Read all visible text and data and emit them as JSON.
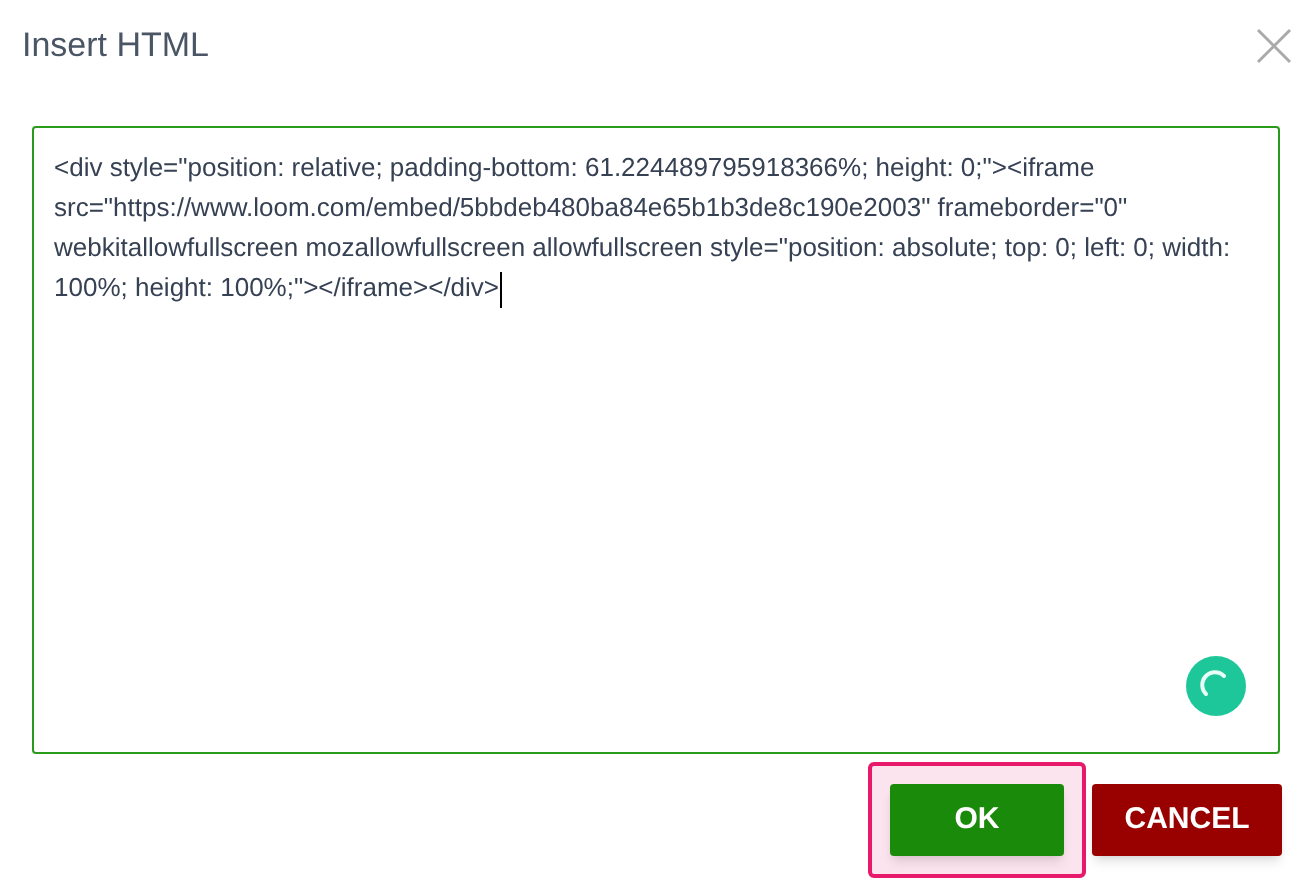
{
  "dialog": {
    "title": "Insert HTML"
  },
  "editor": {
    "value": "<div style=\"position: relative; padding-bottom: 61.224489795918366%; height: 0;\"><iframe src=\"https://www.loom.com/embed/5bbdeb480ba84e65b1b3de8c190e2003\" frameborder=\"0\" webkitallowfullscreen mozallowfullscreen allowfullscreen style=\"position: absolute; top: 0; left: 0; width: 100%; height: 100%;\"></iframe></div>"
  },
  "buttons": [
    {
      "label": "OK",
      "kind": "confirm",
      "focused": true
    },
    {
      "label": "CANCEL",
      "kind": "cancel",
      "focused": false
    }
  ]
}
